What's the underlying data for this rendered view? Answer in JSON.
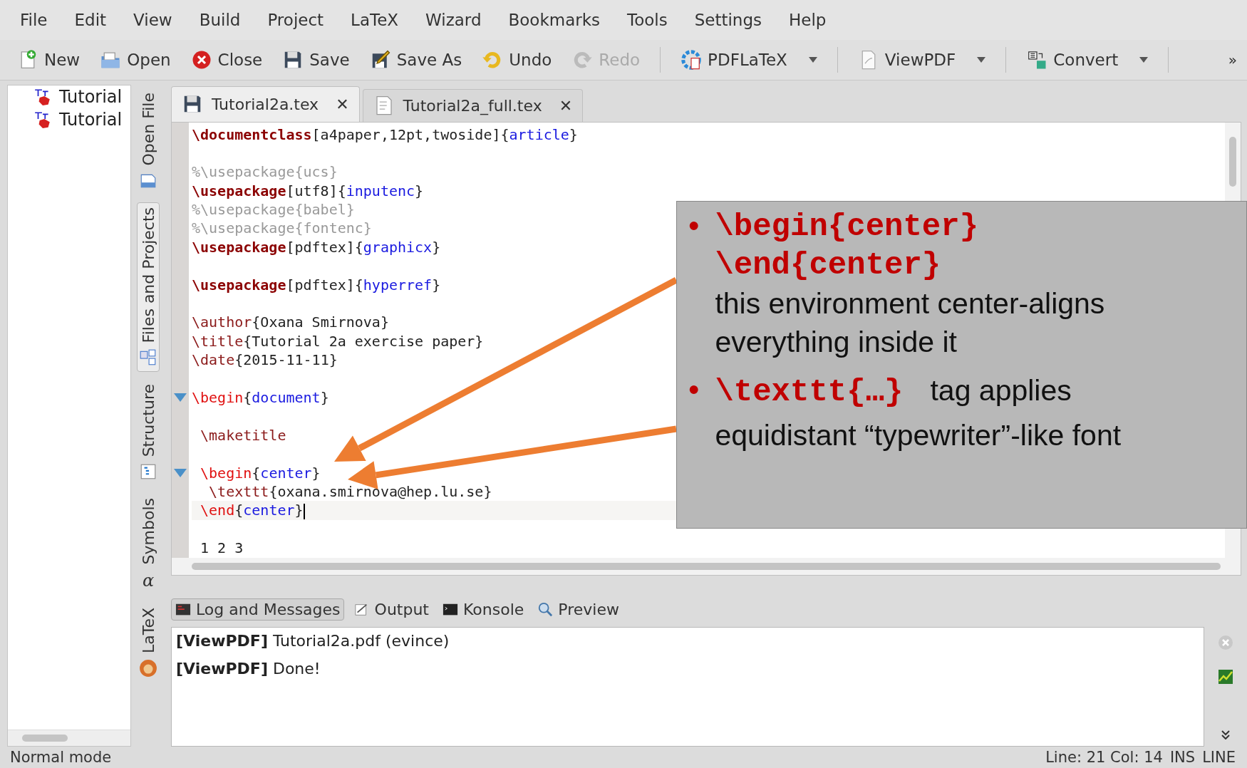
{
  "menu": [
    "File",
    "Edit",
    "View",
    "Build",
    "Project",
    "LaTeX",
    "Wizard",
    "Bookmarks",
    "Tools",
    "Settings",
    "Help"
  ],
  "toolbar": [
    {
      "label": "New",
      "kind": "button",
      "disabled": false
    },
    {
      "label": "Open",
      "kind": "button",
      "disabled": false
    },
    {
      "label": "Close",
      "kind": "button",
      "disabled": false
    },
    {
      "label": "Save",
      "kind": "button",
      "disabled": false
    },
    {
      "label": "Save As",
      "kind": "button",
      "disabled": false
    },
    {
      "label": "Undo",
      "kind": "button",
      "disabled": false
    },
    {
      "label": "Redo",
      "kind": "button",
      "disabled": true
    },
    {
      "label": "PDFLaTeX",
      "kind": "split",
      "disabled": false
    },
    {
      "label": "ViewPDF",
      "kind": "split",
      "disabled": false
    },
    {
      "label": "Convert",
      "kind": "split",
      "disabled": false
    }
  ],
  "toolbar_overflow": "»",
  "file_tree": [
    "Tutorial",
    "Tutorial"
  ],
  "side_tabs": [
    {
      "label": "Open File",
      "selected": false
    },
    {
      "label": "Files and Projects",
      "selected": true
    },
    {
      "label": "Structure",
      "selected": false
    },
    {
      "label": "Symbols",
      "selected": false,
      "icon_text": "α"
    },
    {
      "label": "LaTeX",
      "selected": false
    }
  ],
  "editor_tabs": [
    {
      "label": "Tutorial2a.tex",
      "selected": true,
      "close": "✕"
    },
    {
      "label": "Tutorial2a_full.tex",
      "selected": false,
      "close": "✕"
    }
  ],
  "code_blocks": [
    {
      "lines": [
        {
          "fold": false,
          "current": false,
          "segments": [
            {
              "kind": "kw",
              "text": "\\documentclass"
            },
            {
              "kind": "plain",
              "text": "[a4paper,12pt,twoside]{"
            },
            {
              "kind": "arg",
              "text": "article"
            },
            {
              "kind": "plain",
              "text": "}"
            }
          ]
        }
      ]
    },
    {
      "lines": [
        {
          "fold": false,
          "current": false,
          "segments": [
            {
              "kind": "comment",
              "text": "%\\usepackage{ucs}"
            }
          ]
        },
        {
          "fold": false,
          "current": false,
          "segments": [
            {
              "kind": "kw",
              "text": "\\usepackage"
            },
            {
              "kind": "plain",
              "text": "[utf8]{"
            },
            {
              "kind": "arg",
              "text": "inputenc"
            },
            {
              "kind": "plain",
              "text": "}"
            }
          ]
        },
        {
          "fold": false,
          "current": false,
          "segments": [
            {
              "kind": "comment",
              "text": "%\\usepackage{babel}"
            }
          ]
        },
        {
          "fold": false,
          "current": false,
          "segments": [
            {
              "kind": "comment",
              "text": "%\\usepackage{fontenc}"
            }
          ]
        },
        {
          "fold": false,
          "current": false,
          "segments": [
            {
              "kind": "kw",
              "text": "\\usepackage"
            },
            {
              "kind": "plain",
              "text": "[pdftex]{"
            },
            {
              "kind": "arg",
              "text": "graphicx"
            },
            {
              "kind": "plain",
              "text": "}"
            }
          ]
        }
      ]
    },
    {
      "lines": [
        {
          "fold": false,
          "current": false,
          "segments": [
            {
              "kind": "kw",
              "text": "\\usepackage"
            },
            {
              "kind": "plain",
              "text": "[pdftex]{"
            },
            {
              "kind": "arg",
              "text": "hyperref"
            },
            {
              "kind": "plain",
              "text": "}"
            }
          ]
        }
      ]
    },
    {
      "lines": [
        {
          "fold": false,
          "current": false,
          "segments": [
            {
              "kind": "cmd",
              "text": "\\author"
            },
            {
              "kind": "plain",
              "text": "{Oxana Smirnova}"
            }
          ]
        },
        {
          "fold": false,
          "current": false,
          "segments": [
            {
              "kind": "cmd",
              "text": "\\title"
            },
            {
              "kind": "plain",
              "text": "{Tutorial 2a exercise paper}"
            }
          ]
        },
        {
          "fold": false,
          "current": false,
          "segments": [
            {
              "kind": "cmd",
              "text": "\\date"
            },
            {
              "kind": "plain",
              "text": "{2015-11-11}"
            }
          ]
        }
      ]
    },
    {
      "lines": [
        {
          "fold": true,
          "current": false,
          "segments": [
            {
              "kind": "env",
              "text": "\\begin"
            },
            {
              "kind": "plain",
              "text": "{"
            },
            {
              "kind": "arg",
              "text": "document"
            },
            {
              "kind": "plain",
              "text": "}"
            }
          ]
        }
      ]
    },
    {
      "lines": [
        {
          "fold": false,
          "current": false,
          "segments": [
            {
              "kind": "cmd",
              "text": " \\maketitle"
            }
          ]
        }
      ]
    },
    {
      "lines": [
        {
          "fold": true,
          "current": false,
          "segments": [
            {
              "kind": "env",
              "text": " \\begin"
            },
            {
              "kind": "plain",
              "text": "{"
            },
            {
              "kind": "arg",
              "text": "center"
            },
            {
              "kind": "plain",
              "text": "}"
            }
          ]
        },
        {
          "fold": false,
          "current": false,
          "segments": [
            {
              "kind": "cmd",
              "text": "  \\texttt"
            },
            {
              "kind": "plain",
              "text": "{oxana.smirnova@hep.lu.se}"
            }
          ]
        },
        {
          "fold": false,
          "current": true,
          "segments": [
            {
              "kind": "env",
              "text": " \\end"
            },
            {
              "kind": "plain",
              "text": "{"
            },
            {
              "kind": "arg",
              "text": "center"
            },
            {
              "kind": "plain",
              "text": "}"
            }
          ]
        }
      ]
    },
    {
      "lines": [
        {
          "fold": false,
          "current": false,
          "segments": [
            {
              "kind": "plain",
              "text": " 1 2 3"
            }
          ]
        }
      ]
    }
  ],
  "callout": {
    "bullet": "•",
    "items": [
      {
        "kind": "block",
        "code": [
          "\\begin{center}",
          "\\end{center}"
        ],
        "text": "this environment center-aligns everything inside it"
      },
      {
        "kind": "inline",
        "code": [
          "\\texttt{…}"
        ],
        "text": "tag applies",
        "more_text": "equidistant “typewriter”-like font"
      }
    ]
  },
  "bottom_tabs": [
    {
      "label": "Log and Messages",
      "selected": true
    },
    {
      "label": "Output",
      "selected": false
    },
    {
      "label": "Konsole",
      "selected": false
    },
    {
      "label": "Preview",
      "selected": false
    }
  ],
  "log": [
    "**[ViewPDF]** Tutorial2a.pdf (evince)",
    "**[ViewPDF]** Done!"
  ],
  "status_bar": {
    "mode": "Normal mode",
    "position": "Line: 21 Col: 14",
    "insert_mode": "INS",
    "selection_mode": "LINE"
  }
}
